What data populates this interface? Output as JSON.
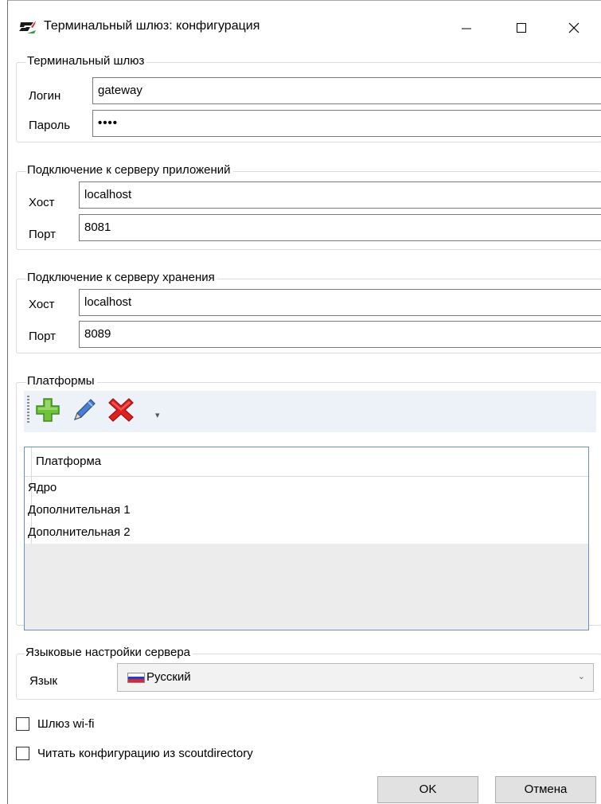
{
  "window": {
    "title": "Терминальный шлюз: конфигурация",
    "app_icon": "scout-logo-icon",
    "controls": {
      "minimize": "minimize-icon",
      "maximize": "maximize-icon",
      "close": "close-icon"
    }
  },
  "gateway": {
    "legend": "Терминальный шлюз",
    "login_label": "Логин",
    "login_value": "gateway",
    "password_label": "Пароль",
    "password_value": "••••"
  },
  "app_server": {
    "legend": "Подключение к серверу приложений",
    "host_label": "Хост",
    "host_value": "localhost",
    "port_label": "Порт",
    "port_value": "8081"
  },
  "storage_server": {
    "legend": "Подключение к серверу хранения",
    "host_label": "Хост",
    "host_value": "localhost",
    "port_label": "Порт",
    "port_value": "8089"
  },
  "platforms": {
    "legend": "Платформы",
    "toolbar": {
      "add_icon": "add-icon",
      "edit_icon": "edit-pencil-icon",
      "delete_icon": "delete-icon",
      "overflow_icon": "overflow-chevron-icon"
    },
    "column_header": "Платформа",
    "rows": [
      "Ядро",
      "Дополнительная 1",
      "Дополнительная 2"
    ]
  },
  "language": {
    "legend": "Языковые настройки сервера",
    "label": "Язык",
    "selected": "Русский",
    "flag_colors": [
      "#ffffff",
      "#1f3fd0",
      "#e0262b"
    ]
  },
  "options": {
    "wifi_label": "Шлюз wi-fi",
    "wifi_checked": false,
    "scoutdirectory_label": "Читать конфигурацию из scoutdirectory",
    "scoutdirectory_checked": false
  },
  "buttons": {
    "ok": "OK",
    "cancel": "Отмена"
  }
}
